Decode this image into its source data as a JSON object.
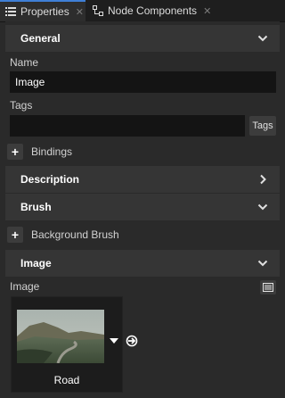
{
  "tabs": [
    {
      "label": "Properties",
      "icon": "list-icon",
      "active": true
    },
    {
      "label": "Node Components",
      "icon": "components-icon",
      "active": false
    }
  ],
  "sections": {
    "general": "General",
    "description": "Description",
    "brush": "Brush",
    "image": "Image"
  },
  "fields": {
    "name_label": "Name",
    "name_value": "Image",
    "tags_label": "Tags",
    "tags_value": "",
    "tags_button": "Tags",
    "bindings_label": "Bindings",
    "background_brush_label": "Background Brush",
    "image_label": "Image",
    "image_asset_name": "Road"
  },
  "colors": {
    "background": "#2a2a2a",
    "section_header": "#353535",
    "input_bg": "#141414",
    "accent": "#3f7fd6"
  }
}
